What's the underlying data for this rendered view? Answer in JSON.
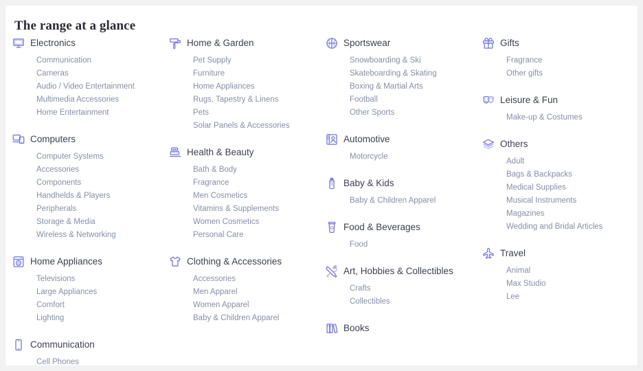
{
  "page": {
    "title": "The range at a glance",
    "accent_color": "#7b7ce0",
    "heading_color": "#3d4150",
    "link_color": "#868fa5",
    "card_background": "#ffffff",
    "page_background": "#f2f2f2"
  },
  "columns": [
    {
      "groups": [
        {
          "title": "Electronics",
          "icon": "monitor-icon",
          "items": [
            "Communication",
            "Cameras",
            "Audio / Video Entertainment",
            "Multimedia Accessories",
            "Home Entertainment"
          ]
        },
        {
          "title": "Computers",
          "icon": "computers-icon",
          "items": [
            "Computer Systems",
            "Accessories",
            "Components",
            "Handhelds & Players",
            "Peripherals",
            "Storage & Media",
            "Wireless & Networking"
          ]
        },
        {
          "title": "Home Appliances",
          "icon": "washing-machine-icon",
          "items": [
            "Televisions",
            "Large Appliances",
            "Comfort",
            "Lighting"
          ]
        },
        {
          "title": "Communication",
          "icon": "mobile-phone-icon",
          "items": [
            "Cell Phones"
          ]
        }
      ]
    },
    {
      "groups": [
        {
          "title": "Home & Garden",
          "icon": "paint-roller-icon",
          "items": [
            "Pet Supply",
            "Furniture",
            "Home Appliances",
            "Rugs, Tapestry & Linens",
            "Pets",
            "Solar Panels & Accessories"
          ]
        },
        {
          "title": "Health & Beauty",
          "icon": "bathroom-scale-icon",
          "items": [
            "Bath & Body",
            "Fragrance",
            "Men Cosmetics",
            "Vitamins & Supplements",
            "Women Cosmetics",
            "Personal Care"
          ]
        },
        {
          "title": "Clothing & Accessories",
          "icon": "tshirt-icon",
          "items": [
            "Accessories",
            "Men Apparel",
            "Women Apparel",
            "Baby & Children Apparel"
          ]
        }
      ]
    },
    {
      "groups": [
        {
          "title": "Sportswear",
          "icon": "basketball-icon",
          "items": [
            "Snowboarding & Ski",
            "Skateboarding & Skating",
            "Boxing & Martial Arts",
            "Football",
            "Other Sports"
          ]
        },
        {
          "title": "Automotive",
          "icon": "car-door-icon",
          "items": [
            "Motorcycle"
          ]
        },
        {
          "title": "Baby & Kids",
          "icon": "baby-bottle-icon",
          "items": [
            "Baby & Children Apparel"
          ]
        },
        {
          "title": "Food & Beverages",
          "icon": "coffee-cup-icon",
          "items": [
            "Food"
          ]
        },
        {
          "title": "Art, Hobbies & Collectibles",
          "icon": "tools-icon",
          "items": [
            "Crafts",
            "Collectibles"
          ]
        },
        {
          "title": "Books",
          "icon": "books-icon",
          "items": []
        }
      ]
    },
    {
      "groups": [
        {
          "title": "Gifts",
          "icon": "gift-box-icon",
          "items": [
            "Fragrance",
            "Other gifts"
          ]
        },
        {
          "title": "Leisure & Fun",
          "icon": "theater-masks-icon",
          "items": [
            "Make-up & Costumes"
          ]
        },
        {
          "title": "Others",
          "icon": "layers-icon",
          "items": [
            "Adult",
            "Bags & Backpacks",
            "Medical Supplies",
            "Musical Instruments",
            "Magazines",
            "Wedding and Bridal Articles"
          ]
        },
        {
          "title": "Travel",
          "icon": "airplane-icon",
          "items": [
            "Animal",
            "Max Studio",
            "Lee"
          ]
        }
      ]
    }
  ]
}
